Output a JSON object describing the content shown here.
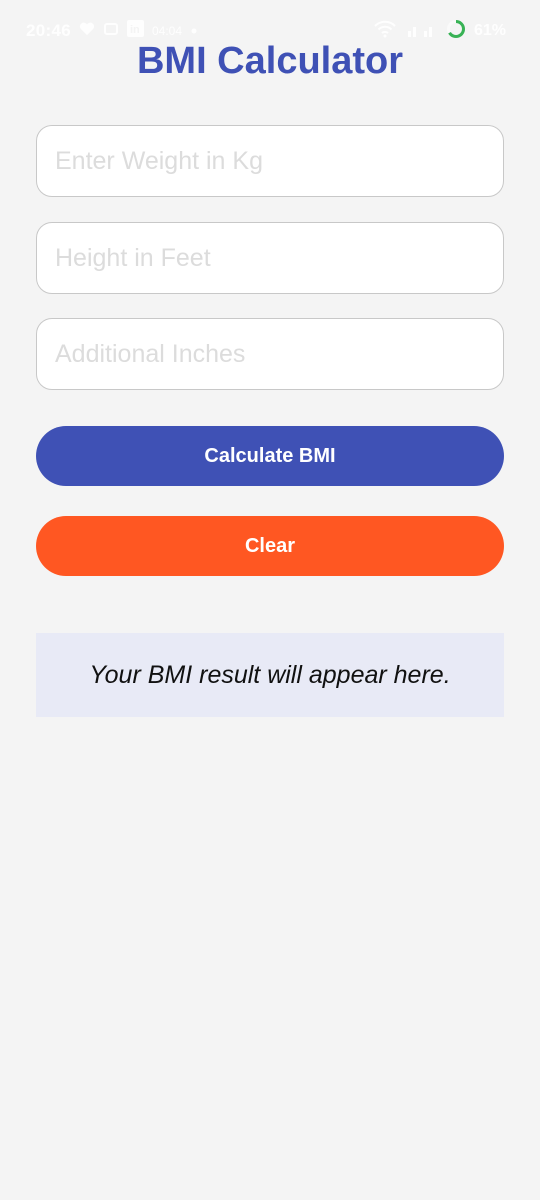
{
  "status_bar": {
    "time": "20:46",
    "notification_text": "04:04",
    "battery_percent": "61%",
    "icons": [
      "heart-icon",
      "sync-icon",
      "linkedin-icon",
      "dot-icon",
      "wifi-icon",
      "signal-icon",
      "battery-ring-icon"
    ],
    "battery_ring_color": "#2eaf4d"
  },
  "title": "BMI Calculator",
  "inputs": [
    {
      "placeholder": "Enter Weight in Kg",
      "value": ""
    },
    {
      "placeholder": "Height in Feet",
      "value": ""
    },
    {
      "placeholder": "Additional Inches",
      "value": ""
    }
  ],
  "buttons": {
    "calculate": "Calculate BMI",
    "clear": "Clear"
  },
  "result": {
    "text": "Your BMI result will appear here."
  },
  "colors": {
    "primary": "#3f51b5",
    "accent": "#ff5722",
    "result_bg": "#e8eaf6",
    "background": "#f4f4f4"
  }
}
